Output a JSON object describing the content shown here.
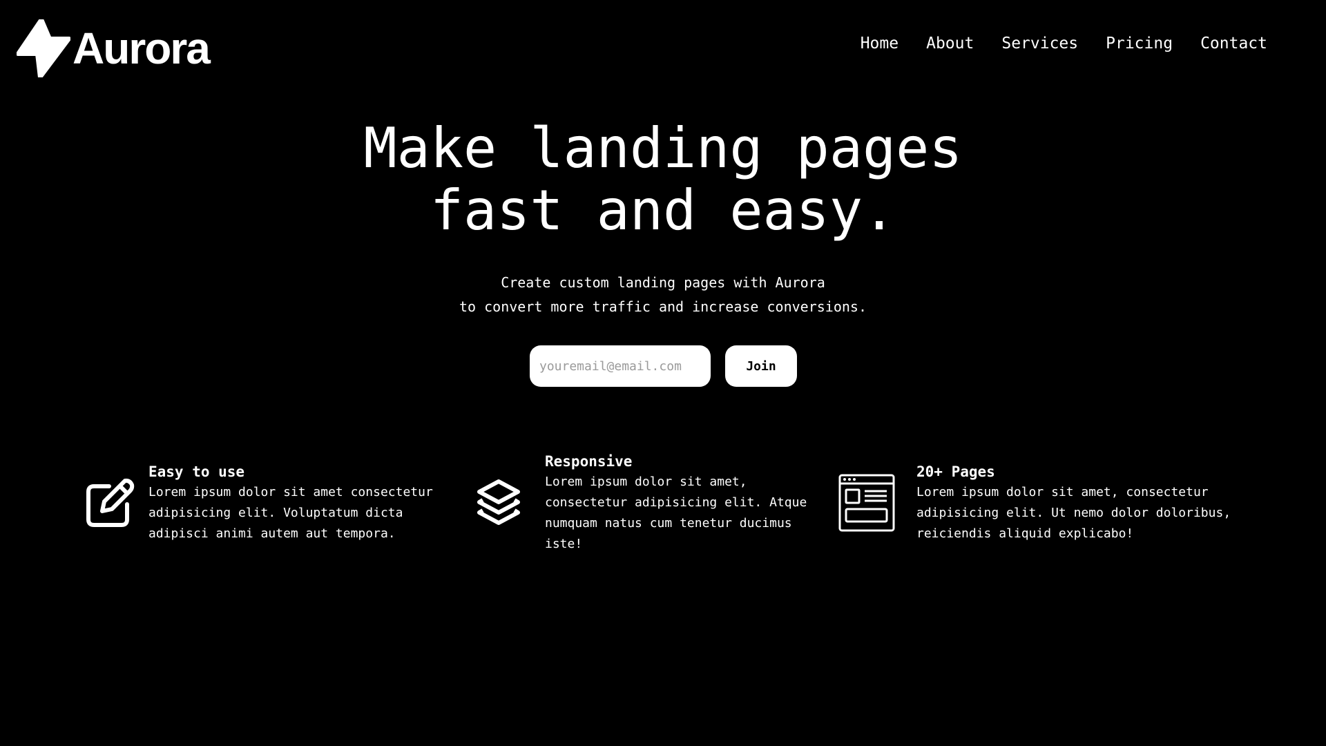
{
  "brand": {
    "name": "Aurora",
    "logo_icon": "lightning-bolt-icon"
  },
  "nav": {
    "items": [
      {
        "label": "Home"
      },
      {
        "label": "About"
      },
      {
        "label": "Services"
      },
      {
        "label": "Pricing"
      },
      {
        "label": "Contact"
      }
    ]
  },
  "hero": {
    "title_line1": "Make landing pages",
    "title_line2": "fast and easy.",
    "subtitle_line1": "Create custom landing pages with Aurora",
    "subtitle_line2": "to convert more traffic and increase conversions."
  },
  "signup": {
    "email_placeholder": "youremail@email.com",
    "email_value": "",
    "join_label": "Join"
  },
  "features": [
    {
      "icon": "edit-pencil-icon",
      "title": "Easy to use",
      "text": "Lorem ipsum dolor sit amet consectetur\nadipisicing elit. Voluptatum dicta\nadipisci animi autem aut tempora."
    },
    {
      "icon": "layers-stack-icon",
      "title": "Responsive",
      "text": "Lorem ipsum dolor sit amet,\nconsectetur adipisicing elit. Atque\nnumquam natus cum tenetur ducimus\niste!"
    },
    {
      "icon": "browser-layout-icon",
      "title": "20+ Pages",
      "text": "Lorem ipsum dolor sit amet, consectetur\nadipisicing elit. Ut nemo dolor doloribus,\nreiciendis aliquid explicabo!"
    }
  ],
  "colors": {
    "background": "#000000",
    "foreground": "#ffffff",
    "placeholder": "#9a9a9a"
  }
}
